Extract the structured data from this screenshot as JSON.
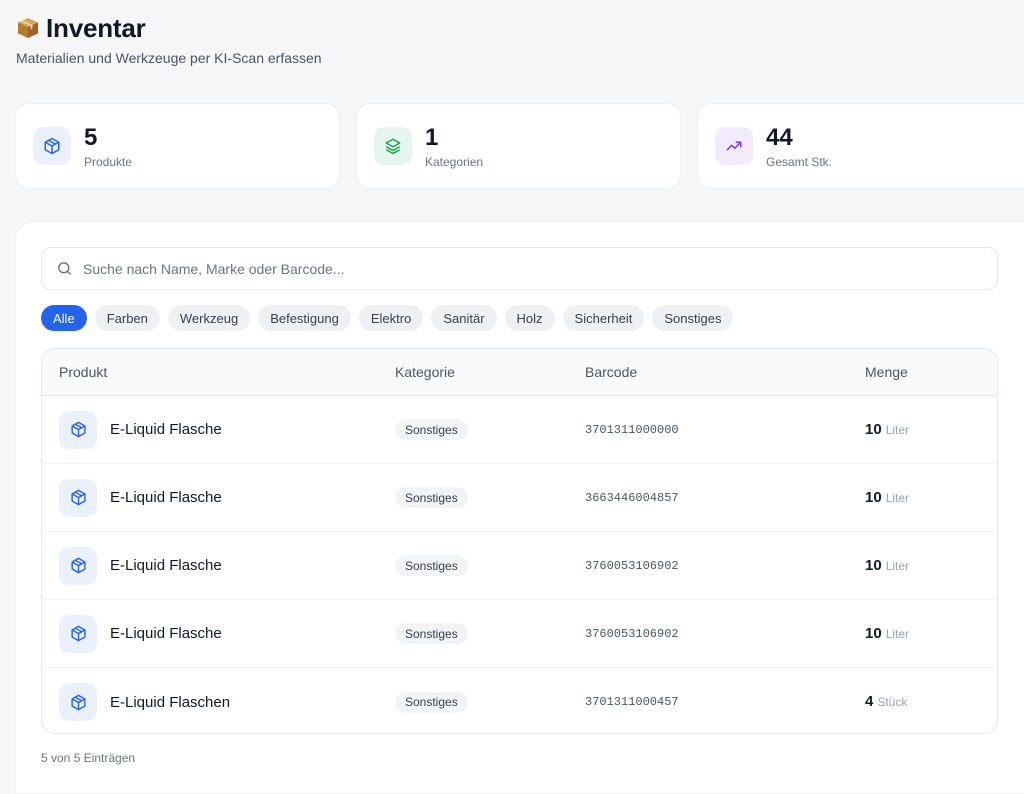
{
  "header": {
    "title": "Inventar",
    "subtitle": "Materialien und Werkzeuge per KI-Scan erfassen",
    "icon": "package-emoji-icon"
  },
  "stats": [
    {
      "value": "5",
      "label": "Produkte",
      "icon": "cube-icon",
      "color": "#2563eb"
    },
    {
      "value": "1",
      "label": "Kategorien",
      "icon": "layers-icon",
      "color": "#16a34a"
    },
    {
      "value": "44",
      "label": "Gesamt Stk.",
      "icon": "trending-up-icon",
      "color": "#7c3aed"
    }
  ],
  "search": {
    "placeholder": "Suche nach Name, Marke oder Barcode...",
    "value": ""
  },
  "filters": {
    "items": [
      "Alle",
      "Farben",
      "Werkzeug",
      "Befestigung",
      "Elektro",
      "Sanitär",
      "Holz",
      "Sicherheit",
      "Sonstiges"
    ],
    "active": "Alle"
  },
  "table": {
    "headers": {
      "product": "Produkt",
      "category": "Kategorie",
      "barcode": "Barcode",
      "quantity": "Menge"
    },
    "rows": [
      {
        "name": "E-Liquid Flasche",
        "category": "Sonstiges",
        "barcode": "3701311000000",
        "qty": "10",
        "unit": "Liter"
      },
      {
        "name": "E-Liquid Flasche",
        "category": "Sonstiges",
        "barcode": "3663446004857",
        "qty": "10",
        "unit": "Liter"
      },
      {
        "name": "E-Liquid Flasche",
        "category": "Sonstiges",
        "barcode": "3760053106902",
        "qty": "10",
        "unit": "Liter"
      },
      {
        "name": "E-Liquid Flasche",
        "category": "Sonstiges",
        "barcode": "3760053106902",
        "qty": "10",
        "unit": "Liter"
      },
      {
        "name": "E-Liquid Flaschen",
        "category": "Sonstiges",
        "barcode": "3701311000457",
        "qty": "4",
        "unit": "Stück"
      }
    ]
  },
  "footer": {
    "count_text": "5 von 5 Einträgen"
  },
  "colors": {
    "accent": "#2563eb",
    "background": "#f5f6f8"
  }
}
